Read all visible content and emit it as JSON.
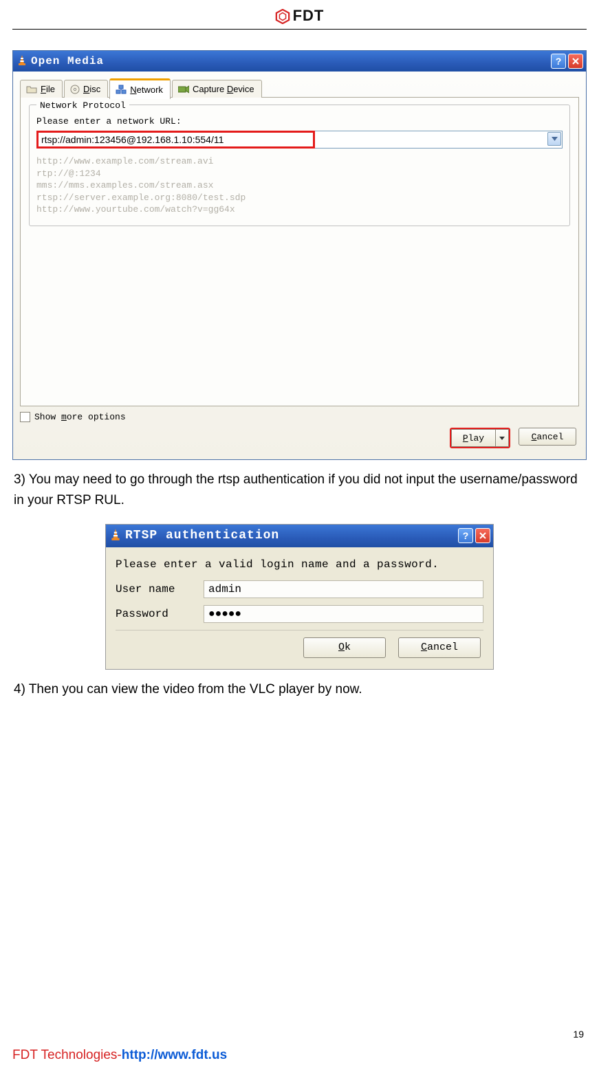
{
  "header": {
    "brand": "FDT"
  },
  "dialog1": {
    "title": "Open Media",
    "tabs": {
      "file": {
        "pre": "",
        "u": "F",
        "post": "ile"
      },
      "disc": {
        "pre": "",
        "u": "D",
        "post": "isc"
      },
      "network": {
        "pre": "",
        "u": "N",
        "post": "etwork"
      },
      "capture": {
        "pre": "Capture ",
        "u": "D",
        "post": "evice"
      }
    },
    "fieldset_legend": "Network Protocol",
    "prompt": "Please enter a network URL:",
    "url_value": "rtsp://admin:123456@192.168.1.10:554/11",
    "examples": "http://www.example.com/stream.avi\nrtp://@:1234\nmms://mms.examples.com/stream.asx\nrtsp://server.example.org:8080/test.sdp\nhttp://www.yourtube.com/watch?v=gg64x",
    "show_more": {
      "pre": "Show ",
      "u": "m",
      "post": "ore options"
    },
    "play": {
      "pre": "",
      "u": "P",
      "post": "lay"
    },
    "cancel": {
      "pre": "",
      "u": "C",
      "post": "ancel"
    }
  },
  "para3": "3) You may need to go through the rtsp authentication if you did not input the username/password in your RTSP RUL.",
  "dialog2": {
    "title": "RTSP authentication",
    "msg": "Please enter a valid login name and a password.",
    "user_label": "User name",
    "user_value": "admin",
    "pass_label": "Password",
    "pass_value": "●●●●●",
    "ok": {
      "pre": "",
      "u": "O",
      "post": "k"
    },
    "cancel": {
      "pre": "",
      "u": "C",
      "post": "ancel"
    }
  },
  "para4": "4) Then you can view the video from the VLC player by now.",
  "footer": {
    "company": "FDT Technologies-",
    "url": "http://www.fdt.us",
    "page_number": "19"
  }
}
